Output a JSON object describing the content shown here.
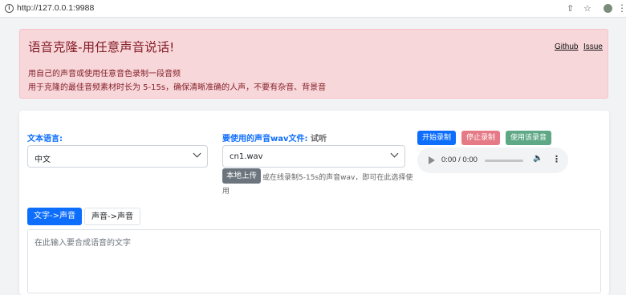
{
  "browser": {
    "url": "http://127.0.0.1:9988"
  },
  "alert": {
    "title": "语音克隆-用任意声音说话!",
    "github": "Github",
    "issue": "Issue",
    "line1": "用自己的声音或使用任意音色录制一段音频",
    "line2": "用于克隆的最佳音频素材时长为 5-15s，确保清晰准确的人声，不要有杂音、背景音"
  },
  "form": {
    "lang_label": "文本语言:",
    "lang_value": "中文",
    "wav_label": "要使用的声音wav文件:",
    "wav_listen": "试听",
    "wav_value": "cn1.wav",
    "upload_label": "本地上传",
    "upload_hint1": "或在线录制5-15s的声音wav，即可在此选择使",
    "upload_hint2": "用",
    "record": {
      "start": "开始录制",
      "stop": "停止录制",
      "use": "使用该录音"
    },
    "audio_time": "0:00 / 0:00",
    "colors": {
      "primary": "#0d6efd",
      "danger": "#e57a86",
      "success": "#5fa886",
      "secondary": "#6c757d"
    }
  },
  "tabs": [
    {
      "label": "文字->声音"
    },
    {
      "label": "声音->声音"
    }
  ],
  "text_input": {
    "placeholder": "在此输入要合成语音的文字"
  }
}
